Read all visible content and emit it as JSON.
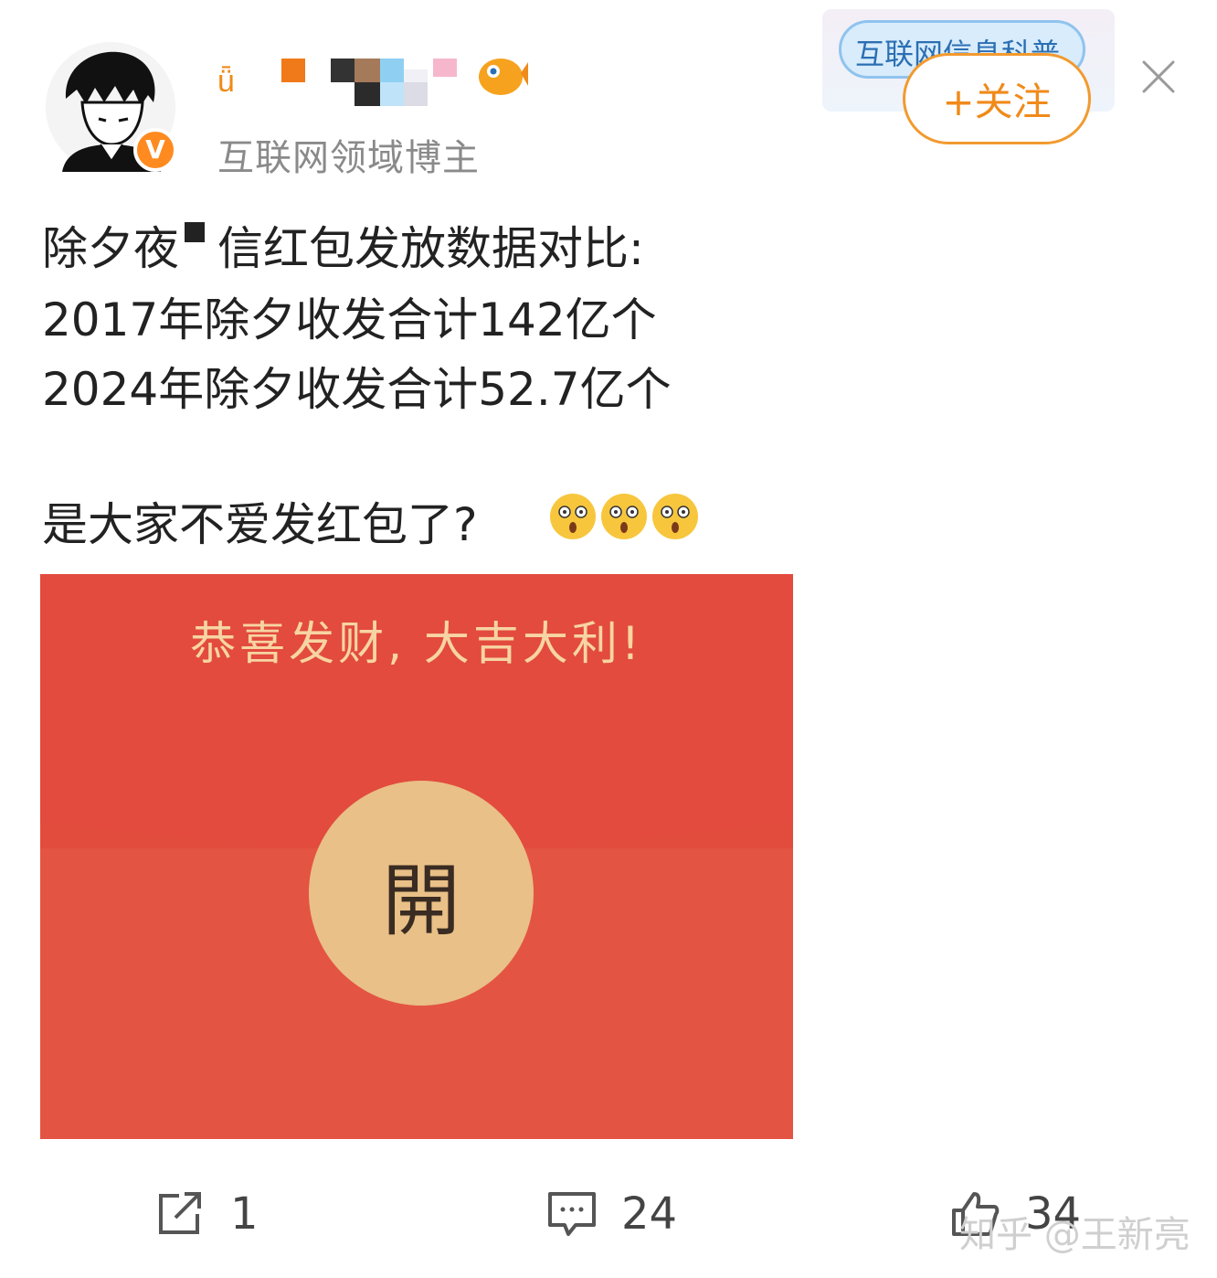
{
  "header": {
    "subtitle": "互联网领域博主",
    "badge_text": "互联网信息科普",
    "follow_label": "+关注"
  },
  "post": {
    "line1_before": "除夕夜",
    "line1_after": "信红包发放数据对比:",
    "line2": "2017年除夕收发合计142亿个",
    "line3": "2024年除夕收发合计52.7亿个",
    "line4": "是大家不爱发红包了?"
  },
  "envelope": {
    "greeting": "恭喜发财, 大吉大利!",
    "open_label": "開",
    "colors": {
      "red": "#e45443",
      "button": "#e9c087",
      "greeting": "#f7d4a3"
    }
  },
  "footer": {
    "shares": "1",
    "comments": "24",
    "likes": "34"
  },
  "watermark": "知乎 @王新亮",
  "colors": {
    "accent": "#f08a1a",
    "verified": "#ff8a1f"
  }
}
